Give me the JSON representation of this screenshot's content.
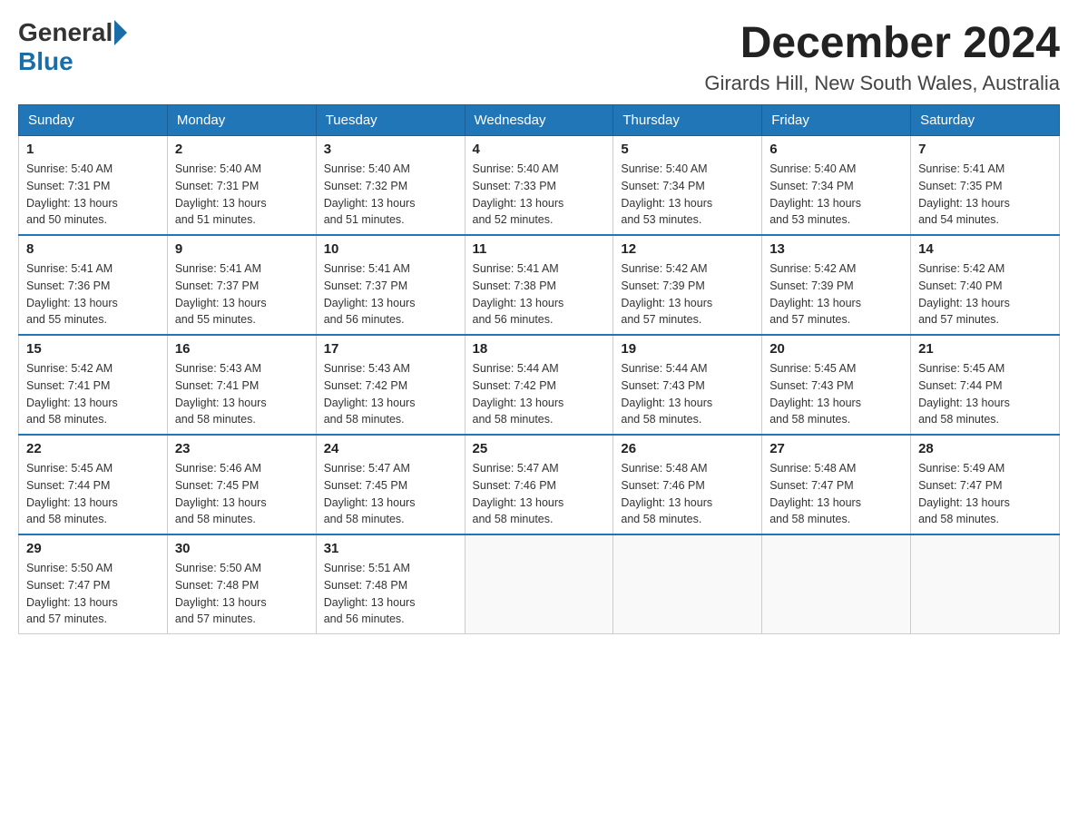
{
  "header": {
    "logo_general": "General",
    "logo_blue": "Blue",
    "title": "December 2024",
    "location": "Girards Hill, New South Wales, Australia"
  },
  "days_of_week": [
    "Sunday",
    "Monday",
    "Tuesday",
    "Wednesday",
    "Thursday",
    "Friday",
    "Saturday"
  ],
  "weeks": [
    [
      {
        "day": "1",
        "sunrise": "5:40 AM",
        "sunset": "7:31 PM",
        "daylight": "13 hours and 50 minutes."
      },
      {
        "day": "2",
        "sunrise": "5:40 AM",
        "sunset": "7:31 PM",
        "daylight": "13 hours and 51 minutes."
      },
      {
        "day": "3",
        "sunrise": "5:40 AM",
        "sunset": "7:32 PM",
        "daylight": "13 hours and 51 minutes."
      },
      {
        "day": "4",
        "sunrise": "5:40 AM",
        "sunset": "7:33 PM",
        "daylight": "13 hours and 52 minutes."
      },
      {
        "day": "5",
        "sunrise": "5:40 AM",
        "sunset": "7:34 PM",
        "daylight": "13 hours and 53 minutes."
      },
      {
        "day": "6",
        "sunrise": "5:40 AM",
        "sunset": "7:34 PM",
        "daylight": "13 hours and 53 minutes."
      },
      {
        "day": "7",
        "sunrise": "5:41 AM",
        "sunset": "7:35 PM",
        "daylight": "13 hours and 54 minutes."
      }
    ],
    [
      {
        "day": "8",
        "sunrise": "5:41 AM",
        "sunset": "7:36 PM",
        "daylight": "13 hours and 55 minutes."
      },
      {
        "day": "9",
        "sunrise": "5:41 AM",
        "sunset": "7:37 PM",
        "daylight": "13 hours and 55 minutes."
      },
      {
        "day": "10",
        "sunrise": "5:41 AM",
        "sunset": "7:37 PM",
        "daylight": "13 hours and 56 minutes."
      },
      {
        "day": "11",
        "sunrise": "5:41 AM",
        "sunset": "7:38 PM",
        "daylight": "13 hours and 56 minutes."
      },
      {
        "day": "12",
        "sunrise": "5:42 AM",
        "sunset": "7:39 PM",
        "daylight": "13 hours and 57 minutes."
      },
      {
        "day": "13",
        "sunrise": "5:42 AM",
        "sunset": "7:39 PM",
        "daylight": "13 hours and 57 minutes."
      },
      {
        "day": "14",
        "sunrise": "5:42 AM",
        "sunset": "7:40 PM",
        "daylight": "13 hours and 57 minutes."
      }
    ],
    [
      {
        "day": "15",
        "sunrise": "5:42 AM",
        "sunset": "7:41 PM",
        "daylight": "13 hours and 58 minutes."
      },
      {
        "day": "16",
        "sunrise": "5:43 AM",
        "sunset": "7:41 PM",
        "daylight": "13 hours and 58 minutes."
      },
      {
        "day": "17",
        "sunrise": "5:43 AM",
        "sunset": "7:42 PM",
        "daylight": "13 hours and 58 minutes."
      },
      {
        "day": "18",
        "sunrise": "5:44 AM",
        "sunset": "7:42 PM",
        "daylight": "13 hours and 58 minutes."
      },
      {
        "day": "19",
        "sunrise": "5:44 AM",
        "sunset": "7:43 PM",
        "daylight": "13 hours and 58 minutes."
      },
      {
        "day": "20",
        "sunrise": "5:45 AM",
        "sunset": "7:43 PM",
        "daylight": "13 hours and 58 minutes."
      },
      {
        "day": "21",
        "sunrise": "5:45 AM",
        "sunset": "7:44 PM",
        "daylight": "13 hours and 58 minutes."
      }
    ],
    [
      {
        "day": "22",
        "sunrise": "5:45 AM",
        "sunset": "7:44 PM",
        "daylight": "13 hours and 58 minutes."
      },
      {
        "day": "23",
        "sunrise": "5:46 AM",
        "sunset": "7:45 PM",
        "daylight": "13 hours and 58 minutes."
      },
      {
        "day": "24",
        "sunrise": "5:47 AM",
        "sunset": "7:45 PM",
        "daylight": "13 hours and 58 minutes."
      },
      {
        "day": "25",
        "sunrise": "5:47 AM",
        "sunset": "7:46 PM",
        "daylight": "13 hours and 58 minutes."
      },
      {
        "day": "26",
        "sunrise": "5:48 AM",
        "sunset": "7:46 PM",
        "daylight": "13 hours and 58 minutes."
      },
      {
        "day": "27",
        "sunrise": "5:48 AM",
        "sunset": "7:47 PM",
        "daylight": "13 hours and 58 minutes."
      },
      {
        "day": "28",
        "sunrise": "5:49 AM",
        "sunset": "7:47 PM",
        "daylight": "13 hours and 58 minutes."
      }
    ],
    [
      {
        "day": "29",
        "sunrise": "5:50 AM",
        "sunset": "7:47 PM",
        "daylight": "13 hours and 57 minutes."
      },
      {
        "day": "30",
        "sunrise": "5:50 AM",
        "sunset": "7:48 PM",
        "daylight": "13 hours and 57 minutes."
      },
      {
        "day": "31",
        "sunrise": "5:51 AM",
        "sunset": "7:48 PM",
        "daylight": "13 hours and 56 minutes."
      },
      null,
      null,
      null,
      null
    ]
  ],
  "labels": {
    "sunrise": "Sunrise:",
    "sunset": "Sunset:",
    "daylight": "Daylight:"
  }
}
